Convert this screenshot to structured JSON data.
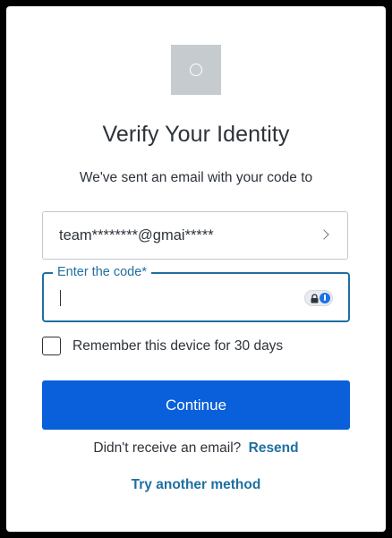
{
  "header": {
    "logo_icon": "circle-placeholder-icon",
    "title": "Verify Your Identity",
    "subtitle": "We've sent an email with your code to"
  },
  "email_selector": {
    "value": "team********@gmai*****",
    "icon": "chevron-right-icon"
  },
  "code_field": {
    "label": "Enter the code*",
    "value": "",
    "placeholder": "",
    "icons": [
      "lock-icon",
      "password-manager-icon"
    ]
  },
  "remember": {
    "label": "Remember this device for 30 days",
    "checked": false
  },
  "continue_button": {
    "label": "Continue"
  },
  "resend": {
    "prompt": "Didn't receive an email?",
    "link": "Resend"
  },
  "alternate": {
    "link": "Try another method"
  },
  "colors": {
    "accent": "#0a5fda",
    "link": "#1f6fa1",
    "text": "#2d333a",
    "logo_bg": "#c5cbcf"
  }
}
